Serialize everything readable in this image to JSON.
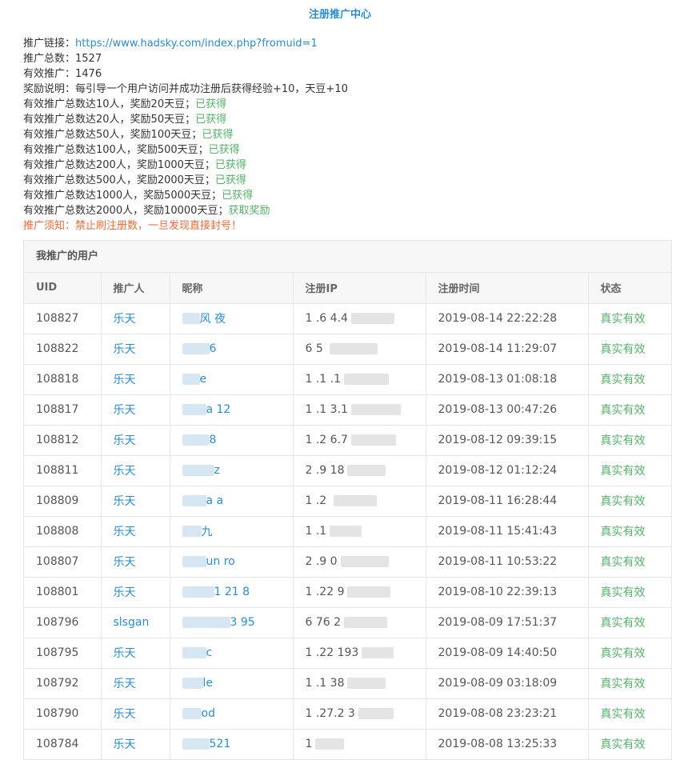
{
  "page": {
    "title": "注册推广中心"
  },
  "info": {
    "link_label": "推广链接：",
    "link_url": "https://www.hadsky.com/index.php?fromuid=1",
    "total_label": "推广总数：",
    "total_value": "1527",
    "valid_label": "有效推广：",
    "valid_value": "1476",
    "reward_desc": "奖励说明：每引导一个用户访问并成功注册后获得经验+10，天豆+10",
    "milestones": [
      {
        "text": "有效推广总数达10人，奖励20天豆；",
        "status": "已获得"
      },
      {
        "text": "有效推广总数达20人，奖励50天豆；",
        "status": "已获得"
      },
      {
        "text": "有效推广总数达50人，奖励100天豆；",
        "status": "已获得"
      },
      {
        "text": "有效推广总数达100人，奖励500天豆；",
        "status": "已获得"
      },
      {
        "text": "有效推广总数达200人，奖励1000天豆；",
        "status": "已获得"
      },
      {
        "text": "有效推广总数达500人，奖励2000天豆；",
        "status": "已获得"
      },
      {
        "text": "有效推广总数达1000人，奖励5000天豆；",
        "status": "已获得"
      },
      {
        "text": "有效推广总数达2000人，奖励10000天豆；",
        "status": "获取奖励"
      }
    ],
    "notice": "推广须知：禁止刷注册数，一旦发现直接封号！"
  },
  "table": {
    "panel_title": "我推广的用户",
    "headers": [
      "UID",
      "推广人",
      "昵称",
      "注册IP",
      "注册时间",
      "状态"
    ],
    "rows": [
      {
        "uid": "108827",
        "promoter": "乐天",
        "nick": "风 夜",
        "ip": "1 .6 4.4",
        "time": "2019-08-14 22:22:28",
        "status": "真实有效"
      },
      {
        "uid": "108822",
        "promoter": "乐天",
        "nick": "6",
        "ip": "6 5 ",
        "time": "2019-08-14 11:29:07",
        "status": "真实有效"
      },
      {
        "uid": "108818",
        "promoter": "乐天",
        "nick": "e",
        "ip": "1 .1 .1",
        "time": "2019-08-13 01:08:18",
        "status": "真实有效"
      },
      {
        "uid": "108817",
        "promoter": "乐天",
        "nick": "a 12",
        "ip": "1 .1 3.1",
        "time": "2019-08-13 00:47:26",
        "status": "真实有效"
      },
      {
        "uid": "108812",
        "promoter": "乐天",
        "nick": "8",
        "ip": "1 .2 6.7",
        "time": "2019-08-12 09:39:15",
        "status": "真实有效"
      },
      {
        "uid": "108811",
        "promoter": "乐天",
        "nick": "z",
        "ip": "2 .9 18",
        "time": "2019-08-12 01:12:24",
        "status": "真实有效"
      },
      {
        "uid": "108809",
        "promoter": "乐天",
        "nick": "a a",
        "ip": "1 .2 ",
        "time": "2019-08-11 16:28:44",
        "status": "真实有效"
      },
      {
        "uid": "108808",
        "promoter": "乐天",
        "nick": "九",
        "ip": "1 .1",
        "time": "2019-08-11 15:41:43",
        "status": "真实有效"
      },
      {
        "uid": "108807",
        "promoter": "乐天",
        "nick": "un ro",
        "ip": "2 .9 0",
        "time": "2019-08-11 10:53:22",
        "status": "真实有效"
      },
      {
        "uid": "108801",
        "promoter": "乐天",
        "nick": "1 21 8",
        "ip": "1 .22 9",
        "time": "2019-08-10 22:39:13",
        "status": "真实有效"
      },
      {
        "uid": "108796",
        "promoter": "slsgan",
        "nick": "3 95",
        "ip": "6 76 2",
        "time": "2019-08-09 17:51:37",
        "status": "真实有效"
      },
      {
        "uid": "108795",
        "promoter": "乐天",
        "nick": "c",
        "ip": "1 .22 193",
        "time": "2019-08-09 14:40:50",
        "status": "真实有效"
      },
      {
        "uid": "108792",
        "promoter": "乐天",
        "nick": "le",
        "ip": "1 .1 38",
        "time": "2019-08-09 03:18:09",
        "status": "真实有效"
      },
      {
        "uid": "108790",
        "promoter": "乐天",
        "nick": "od",
        "ip": "1 .27.2 3",
        "time": "2019-08-08 23:23:21",
        "status": "真实有效"
      },
      {
        "uid": "108784",
        "promoter": "乐天",
        "nick": "521",
        "ip": "1",
        "time": "2019-08-08 13:25:33",
        "status": "真实有效"
      }
    ]
  }
}
